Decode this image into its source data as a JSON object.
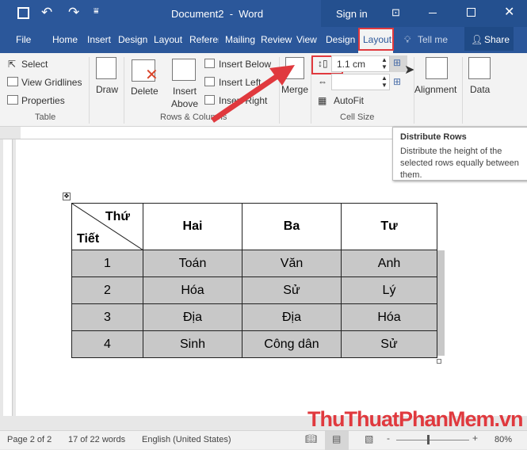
{
  "titlebar": {
    "title": "Document2  -  Word",
    "sign_in": "Sign in"
  },
  "tabs": [
    "File",
    "Home",
    "Insert",
    "Design",
    "Layout",
    "Referer",
    "Mailing",
    "Review",
    "View",
    "Design",
    "Layout"
  ],
  "tell_me": "Tell me",
  "share": "Share",
  "ribbon": {
    "select": "Select",
    "view_gridlines": "View Gridlines",
    "properties": "Properties",
    "draw": "Draw",
    "delete": "Delete",
    "insert_above_1": "Insert",
    "insert_above_2": "Above",
    "insert_below": "Insert Below",
    "insert_left": "Insert Left",
    "insert_right": "Insert Right",
    "merge": "Merge",
    "height_value": "1.1 cm",
    "width_value": "",
    "autofit": "AutoFit",
    "alignment": "Alignment",
    "data": "Data",
    "groups": {
      "table": "Table",
      "rows_columns": "Rows & Columns",
      "cell_size": "Cell Size"
    }
  },
  "tooltip": {
    "title": "Distribute Rows",
    "body": "Distribute the height of the selected rows equally between them."
  },
  "table": {
    "corner_top": "Thứ",
    "corner_bottom": "Tiết",
    "headers": [
      "Hai",
      "Ba",
      "Tư"
    ],
    "rows": [
      [
        "1",
        "Toán",
        "Văn",
        "Anh"
      ],
      [
        "2",
        "Hóa",
        "Sử",
        "Lý"
      ],
      [
        "3",
        "Địa",
        "Địa",
        "Hóa"
      ],
      [
        "4",
        "Sinh",
        "Công dân",
        "Sử"
      ]
    ]
  },
  "status": {
    "page": "Page 2 of 2",
    "words": "17 of 22 words",
    "language": "English (United States)",
    "zoom": "80%",
    "zoom_level_percent": 80
  },
  "watermark": "ThuThuatPhanMem.vn",
  "colors": {
    "accent": "#2b579a",
    "highlight": "#e0393e"
  }
}
